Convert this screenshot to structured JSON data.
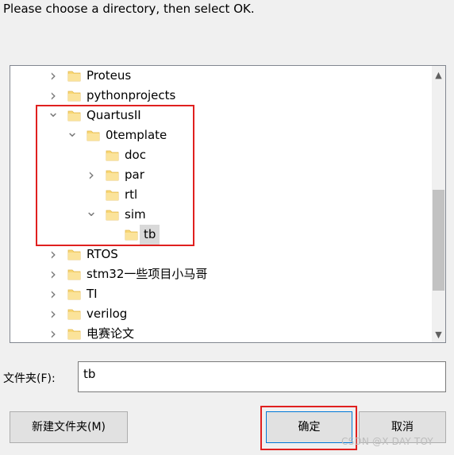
{
  "prompt": "Please choose a directory, then select OK.",
  "tree": [
    {
      "label": "Proteus",
      "expander": ">"
    },
    {
      "label": "pythonprojects",
      "expander": ">"
    },
    {
      "label": "QuartusII",
      "expander": "v"
    },
    {
      "label": "0template",
      "expander": "v"
    },
    {
      "label": "doc",
      "expander": ""
    },
    {
      "label": "par",
      "expander": ">"
    },
    {
      "label": "rtl",
      "expander": ""
    },
    {
      "label": "sim",
      "expander": "v"
    },
    {
      "label": "tb",
      "expander": "",
      "selected": true
    },
    {
      "label": "RTOS",
      "expander": ">"
    },
    {
      "label": "stm32一些项目小马哥",
      "expander": ">"
    },
    {
      "label": "TI",
      "expander": ">"
    },
    {
      "label": "verilog",
      "expander": ">"
    },
    {
      "label": "电赛论文",
      "expander": ">"
    }
  ],
  "folder_label": "文件夹(F):",
  "folder_value": "tb",
  "buttons": {
    "new_folder": "新建文件夹(M)",
    "ok": "确定",
    "cancel": "取消"
  },
  "watermark": "CSDN @X DAY TOY",
  "colors": {
    "highlight": "#e0201f",
    "folder": "#f8d775",
    "selection": "#d9d9d9"
  }
}
